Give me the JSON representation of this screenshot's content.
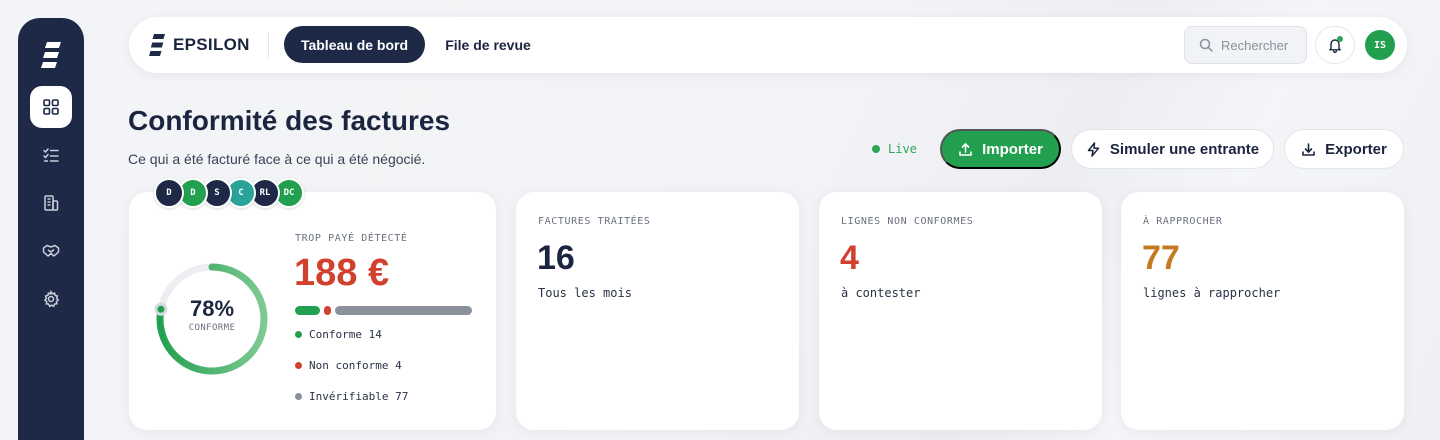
{
  "brand": {
    "name": "EPSILON"
  },
  "nav": {
    "tabs": [
      "Tableau de bord",
      "File de revue"
    ]
  },
  "search": {
    "placeholder": "Rechercher"
  },
  "user": {
    "initials": "IS"
  },
  "page": {
    "title": "Conformité des factures",
    "subtitle": "Ce qui a été facturé face à ce qui a été négocié."
  },
  "status": {
    "live": "Live"
  },
  "actions": {
    "import": "Importer",
    "simulate": "Simuler une entrante",
    "export": "Exporter"
  },
  "collaborators": [
    {
      "initials": "D",
      "color": "#1d2947"
    },
    {
      "initials": "D",
      "color": "#22a04f"
    },
    {
      "initials": "S",
      "color": "#1d2947"
    },
    {
      "initials": "C",
      "color": "#2aa39a"
    },
    {
      "initials": "RL",
      "color": "#1d2947"
    },
    {
      "initials": "DC",
      "color": "#22a04f"
    }
  ],
  "compliance": {
    "percent": 78,
    "percent_label": "78%",
    "ring_label": "CONFORME",
    "overpaid_label": "TROP PAYÉ DÉTECTÉ",
    "overpaid_value": "188 €",
    "breakdown": [
      {
        "label": "Conforme 14",
        "count": 14,
        "color": "#22a04f"
      },
      {
        "label": "Non conforme 4",
        "count": 4,
        "color": "#d2412e"
      },
      {
        "label": "Invérifiable 77",
        "count": 77,
        "color": "#8a909c"
      }
    ]
  },
  "kpis": [
    {
      "label": "FACTURES TRAITÉES",
      "value": "16",
      "desc": "Tous les mois",
      "color": "#1c2540"
    },
    {
      "label": "LIGNES NON CONFORMES",
      "value": "4",
      "desc": "à contester",
      "color": "#d2412e"
    },
    {
      "label": "À RAPPROCHER",
      "value": "77",
      "desc": "lignes à rapprocher",
      "color": "#c47a1e"
    }
  ],
  "colors": {
    "navy": "#1d2947",
    "green": "#22a04f",
    "red": "#d2412e",
    "orange": "#c47a1e"
  },
  "icons": {
    "sidebar": [
      "dashboard-grid-icon",
      "checklist-icon",
      "building-icon",
      "handshake-icon",
      "gear-icon"
    ]
  }
}
